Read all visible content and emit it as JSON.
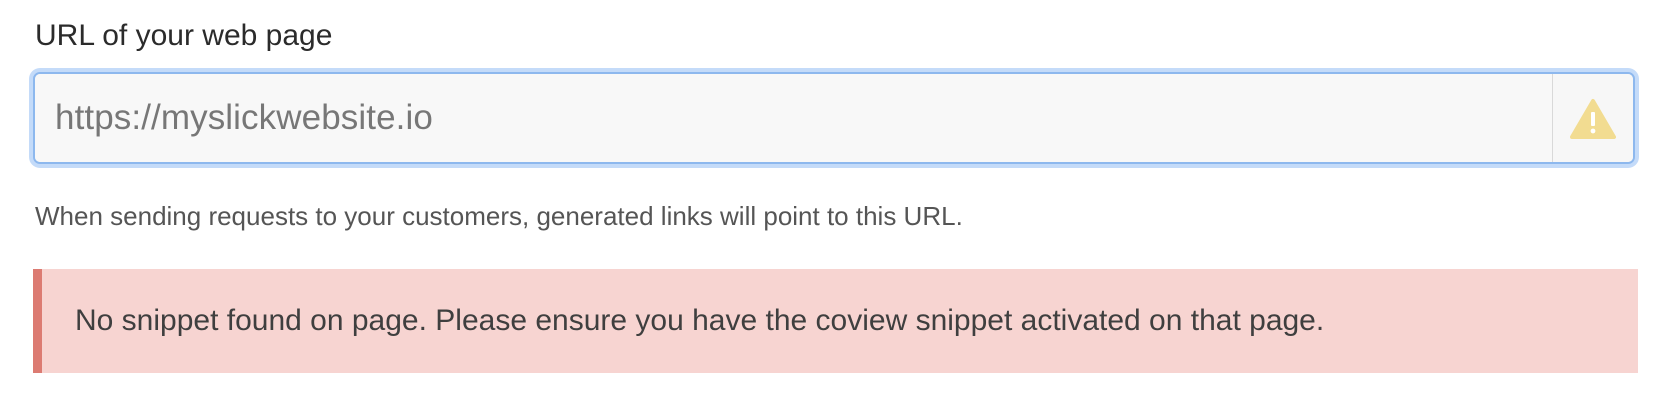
{
  "field": {
    "label": "URL of your web page",
    "url_value": "https://myslickwebsite.io",
    "status_icon": "warning-icon",
    "help_text": "When sending requests to your customers, generated links will point to this URL."
  },
  "alert": {
    "type": "error",
    "message": "No snippet found on page. Please ensure you have the coview snippet activated on that page."
  },
  "colors": {
    "focus_border": "#8db8ee",
    "focus_glow": "#adcdf7",
    "warning_icon": "#f2dc91",
    "alert_background": "#f7d4d1",
    "alert_border": "#dc7b72"
  }
}
